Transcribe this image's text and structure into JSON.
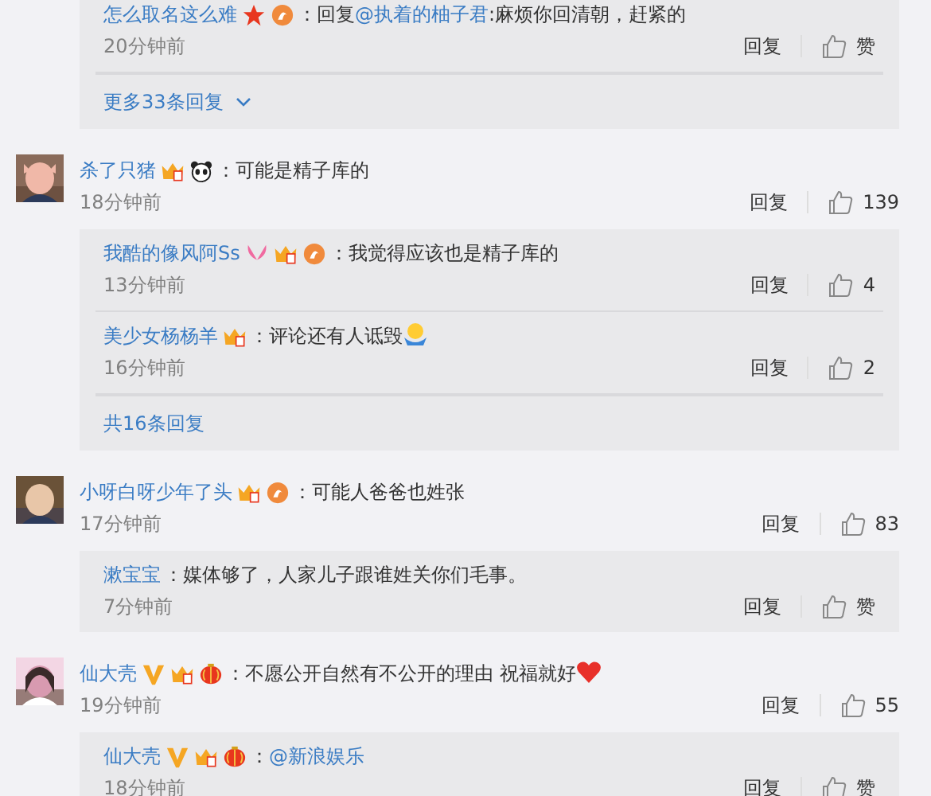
{
  "items": [
    {
      "kind": "reply_box",
      "replies": [
        {
          "user": "怎么取名这么难",
          "badges": [
            {
              "kind": "star"
            },
            {
              "kind": "flame"
            }
          ],
          "text": [
            {
              "text": "：回复"
            },
            {
              "text": "@执着的柚子君",
              "kind": "mention"
            },
            {
              "text": ":麻烦你回清朝，赶紧的"
            }
          ],
          "time": "20分钟前",
          "reply": "回复",
          "likes": "赞"
        }
      ],
      "footer": "更多33条回复",
      "footer_chevron": true
    },
    {
      "kind": "comment",
      "avatar": {
        "kind": "picture"
      },
      "user": "杀了只猪",
      "badges": [
        {
          "kind": "crown"
        },
        {
          "kind": "panda"
        }
      ],
      "text": [
        {
          "text": "：可能是精子库的"
        }
      ],
      "time": "18分钟前",
      "reply": "回复",
      "likes": "139"
    },
    {
      "kind": "reply_box",
      "replies": [
        {
          "user": "我酷的像风阿Ss",
          "badges": [
            {
              "kind": "butterfly"
            },
            {
              "kind": "crown"
            },
            {
              "kind": "flame"
            }
          ],
          "text": [
            {
              "text": "：我觉得应该也是精子库的"
            }
          ],
          "time": "13分钟前",
          "reply": "回复",
          "likes": "4"
        },
        {
          "user": "美少女杨杨羊",
          "badges": [
            {
              "kind": "crown"
            }
          ],
          "text": [
            {
              "text": "：评论还有人诋毁"
            },
            {
              "kind": "smiley"
            }
          ],
          "time": "16分钟前",
          "reply": "回复",
          "likes": "2"
        }
      ],
      "footer": "共16条回复",
      "footer_chevron": false
    },
    {
      "kind": "comment",
      "avatar": {
        "kind": "picture"
      },
      "user": "小呀白呀少年了头",
      "badges": [
        {
          "kind": "crown"
        },
        {
          "kind": "flame"
        }
      ],
      "text": [
        {
          "text": "：可能人爸爸也姓张"
        }
      ],
      "time": "17分钟前",
      "reply": "回复",
      "likes": "83"
    },
    {
      "kind": "reply_box",
      "replies": [
        {
          "user": "漱宝宝",
          "text": [
            {
              "text": "：媒体够了，人家儿子跟谁姓关你们毛事。"
            }
          ],
          "time": "7分钟前",
          "reply": "回复",
          "likes": "赞"
        }
      ]
    },
    {
      "kind": "comment",
      "avatar": {
        "kind": "picture"
      },
      "user": "仙大壳",
      "badges": [
        {
          "kind": "v"
        },
        {
          "kind": "crown"
        },
        {
          "kind": "lantern"
        }
      ],
      "text": [
        {
          "text": "：不愿公开自然有不公开的理由 祝福就好"
        },
        {
          "kind": "heart"
        }
      ],
      "time": "19分钟前",
      "reply": "回复",
      "likes": "55"
    },
    {
      "kind": "reply_box",
      "replies": [
        {
          "user": "仙大壳",
          "badges": [
            {
              "kind": "v"
            },
            {
              "kind": "crown"
            },
            {
              "kind": "lantern"
            }
          ],
          "text": [
            {
              "text": "："
            },
            {
              "text": "@新浪娱乐",
              "kind": "mention"
            }
          ],
          "time": "18分钟前",
          "reply": "回复",
          "likes": "赞"
        }
      ]
    }
  ]
}
